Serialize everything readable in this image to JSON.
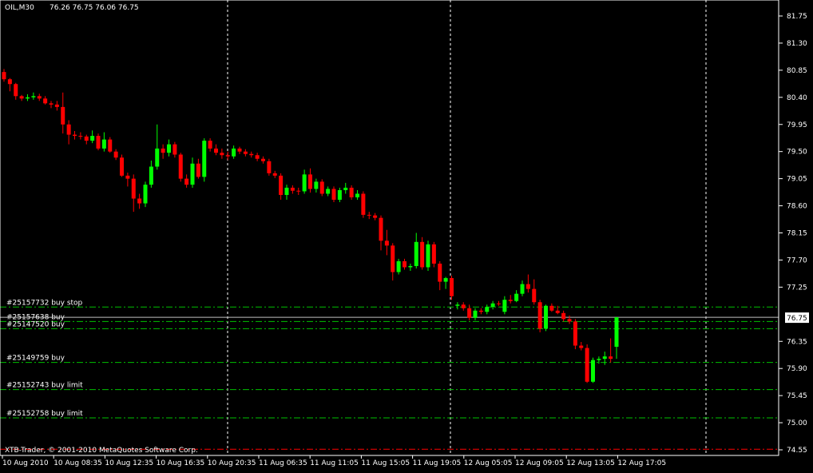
{
  "header": {
    "symbol_timeframe": "OIL,M30",
    "ohlc_readout": "76.26 76.75 76.06 76.75"
  },
  "footer": {
    "copyright": "XTB-Trader, © 2001-2010 MetaQuotes Software Corp."
  },
  "current_price_label": "76.75",
  "colors": {
    "background": "#000000",
    "axis": "#ffffff",
    "bull": "#00ff00",
    "bear": "#ff0000",
    "order_line": "#00c000",
    "current_price_box": "#ffffff",
    "stop_line": "#ff0000"
  },
  "chart_data": {
    "type": "candlestick",
    "ylim": [
      74.5,
      82.0
    ],
    "yticks": [
      "81.75",
      "81.30",
      "80.85",
      "80.40",
      "79.95",
      "79.50",
      "79.05",
      "78.60",
      "78.15",
      "77.70",
      "77.25",
      "76.35",
      "75.90",
      "75.45",
      "75.00",
      "74.55"
    ],
    "xticks": [
      "10 Aug 2010",
      "10 Aug 08:35",
      "10 Aug 12:35",
      "10 Aug 16:35",
      "10 Aug 20:35",
      "11 Aug 06:35",
      "11 Aug 11:05",
      "11 Aug 15:05",
      "11 Aug 19:05",
      "12 Aug 05:05",
      "12 Aug 09:05",
      "12 Aug 13:05",
      "12 Aug 17:05"
    ],
    "vertical_grid_after_tick_index": [
      4,
      8,
      12
    ],
    "candles": [
      {
        "o": 80.82,
        "h": 80.87,
        "l": 80.66,
        "c": 80.7
      },
      {
        "o": 80.7,
        "h": 80.72,
        "l": 80.5,
        "c": 80.62
      },
      {
        "o": 80.62,
        "h": 80.64,
        "l": 80.36,
        "c": 80.42
      },
      {
        "o": 80.42,
        "h": 80.44,
        "l": 80.34,
        "c": 80.38
      },
      {
        "o": 80.38,
        "h": 80.45,
        "l": 80.34,
        "c": 80.4
      },
      {
        "o": 80.4,
        "h": 80.48,
        "l": 80.36,
        "c": 80.42
      },
      {
        "o": 80.42,
        "h": 80.46,
        "l": 80.34,
        "c": 80.38
      },
      {
        "o": 80.38,
        "h": 80.42,
        "l": 80.28,
        "c": 80.3
      },
      {
        "o": 80.3,
        "h": 80.34,
        "l": 80.22,
        "c": 80.28
      },
      {
        "o": 80.28,
        "h": 80.34,
        "l": 80.18,
        "c": 80.24
      },
      {
        "o": 80.24,
        "h": 80.48,
        "l": 79.8,
        "c": 79.95
      },
      {
        "o": 79.95,
        "h": 80.02,
        "l": 79.62,
        "c": 79.78
      },
      {
        "o": 79.78,
        "h": 79.84,
        "l": 79.7,
        "c": 79.76
      },
      {
        "o": 79.76,
        "h": 79.82,
        "l": 79.7,
        "c": 79.75
      },
      {
        "o": 79.75,
        "h": 79.78,
        "l": 79.62,
        "c": 79.68
      },
      {
        "o": 79.68,
        "h": 79.85,
        "l": 79.64,
        "c": 79.76
      },
      {
        "o": 79.76,
        "h": 79.8,
        "l": 79.52,
        "c": 79.55
      },
      {
        "o": 79.55,
        "h": 79.82,
        "l": 79.5,
        "c": 79.7
      },
      {
        "o": 79.7,
        "h": 79.74,
        "l": 79.48,
        "c": 79.5
      },
      {
        "o": 79.5,
        "h": 79.54,
        "l": 79.36,
        "c": 79.4
      },
      {
        "o": 79.4,
        "h": 79.45,
        "l": 79.08,
        "c": 79.1
      },
      {
        "o": 79.1,
        "h": 79.15,
        "l": 78.92,
        "c": 79.05
      },
      {
        "o": 79.05,
        "h": 79.12,
        "l": 78.5,
        "c": 78.72
      },
      {
        "o": 78.72,
        "h": 78.8,
        "l": 78.55,
        "c": 78.64
      },
      {
        "o": 78.64,
        "h": 79.0,
        "l": 78.58,
        "c": 78.95
      },
      {
        "o": 78.95,
        "h": 79.35,
        "l": 78.9,
        "c": 79.25
      },
      {
        "o": 79.25,
        "h": 79.95,
        "l": 79.2,
        "c": 79.55
      },
      {
        "o": 79.55,
        "h": 79.62,
        "l": 79.38,
        "c": 79.48
      },
      {
        "o": 79.48,
        "h": 79.7,
        "l": 79.42,
        "c": 79.62
      },
      {
        "o": 79.62,
        "h": 79.66,
        "l": 79.4,
        "c": 79.45
      },
      {
        "o": 79.45,
        "h": 79.48,
        "l": 79.0,
        "c": 79.05
      },
      {
        "o": 79.05,
        "h": 79.12,
        "l": 78.9,
        "c": 78.95
      },
      {
        "o": 78.95,
        "h": 79.4,
        "l": 78.9,
        "c": 79.3
      },
      {
        "o": 79.3,
        "h": 79.38,
        "l": 79.05,
        "c": 79.08
      },
      {
        "o": 79.08,
        "h": 79.72,
        "l": 79.0,
        "c": 79.68
      },
      {
        "o": 79.68,
        "h": 79.72,
        "l": 79.5,
        "c": 79.55
      },
      {
        "o": 79.55,
        "h": 79.62,
        "l": 79.44,
        "c": 79.48
      },
      {
        "o": 79.48,
        "h": 79.55,
        "l": 79.38,
        "c": 79.44
      },
      {
        "o": 79.44,
        "h": 79.5,
        "l": 79.36,
        "c": 79.42
      },
      {
        "o": 79.42,
        "h": 79.6,
        "l": 79.38,
        "c": 79.55
      },
      {
        "o": 79.55,
        "h": 79.58,
        "l": 79.46,
        "c": 79.5
      },
      {
        "o": 79.5,
        "h": 79.54,
        "l": 79.42,
        "c": 79.46
      },
      {
        "o": 79.46,
        "h": 79.5,
        "l": 79.4,
        "c": 79.44
      },
      {
        "o": 79.44,
        "h": 79.48,
        "l": 79.34,
        "c": 79.38
      },
      {
        "o": 79.38,
        "h": 79.42,
        "l": 79.3,
        "c": 79.34
      },
      {
        "o": 79.34,
        "h": 79.38,
        "l": 79.1,
        "c": 79.14
      },
      {
        "o": 79.14,
        "h": 79.18,
        "l": 79.06,
        "c": 79.1
      },
      {
        "o": 79.1,
        "h": 79.14,
        "l": 78.7,
        "c": 78.78
      },
      {
        "o": 78.78,
        "h": 78.95,
        "l": 78.7,
        "c": 78.9
      },
      {
        "o": 78.9,
        "h": 78.94,
        "l": 78.8,
        "c": 78.85
      },
      {
        "o": 78.85,
        "h": 78.9,
        "l": 78.78,
        "c": 78.84
      },
      {
        "o": 78.84,
        "h": 79.2,
        "l": 78.8,
        "c": 79.12
      },
      {
        "o": 79.12,
        "h": 79.22,
        "l": 78.82,
        "c": 78.88
      },
      {
        "o": 78.88,
        "h": 79.05,
        "l": 78.82,
        "c": 79.0
      },
      {
        "o": 79.0,
        "h": 79.04,
        "l": 78.76,
        "c": 78.8
      },
      {
        "o": 78.8,
        "h": 78.92,
        "l": 78.76,
        "c": 78.88
      },
      {
        "o": 78.88,
        "h": 78.92,
        "l": 78.66,
        "c": 78.7
      },
      {
        "o": 78.7,
        "h": 78.9,
        "l": 78.66,
        "c": 78.86
      },
      {
        "o": 78.86,
        "h": 78.98,
        "l": 78.8,
        "c": 78.9
      },
      {
        "o": 78.9,
        "h": 78.94,
        "l": 78.7,
        "c": 78.74
      },
      {
        "o": 78.74,
        "h": 78.86,
        "l": 78.7,
        "c": 78.8
      },
      {
        "o": 78.8,
        "h": 78.84,
        "l": 78.4,
        "c": 78.45
      },
      {
        "o": 78.45,
        "h": 78.5,
        "l": 78.38,
        "c": 78.44
      },
      {
        "o": 78.44,
        "h": 78.48,
        "l": 78.36,
        "c": 78.4
      },
      {
        "o": 78.4,
        "h": 78.44,
        "l": 77.86,
        "c": 78.02
      },
      {
        "o": 78.02,
        "h": 78.2,
        "l": 77.78,
        "c": 77.94
      },
      {
        "o": 77.94,
        "h": 77.98,
        "l": 77.36,
        "c": 77.5
      },
      {
        "o": 77.5,
        "h": 77.72,
        "l": 77.46,
        "c": 77.68
      },
      {
        "o": 77.68,
        "h": 77.72,
        "l": 77.54,
        "c": 77.58
      },
      {
        "o": 77.58,
        "h": 77.64,
        "l": 77.52,
        "c": 77.6
      },
      {
        "o": 77.6,
        "h": 78.15,
        "l": 77.56,
        "c": 78.0
      },
      {
        "o": 78.0,
        "h": 78.08,
        "l": 77.54,
        "c": 77.58
      },
      {
        "o": 77.58,
        "h": 78.02,
        "l": 77.52,
        "c": 77.96
      },
      {
        "o": 77.96,
        "h": 78.0,
        "l": 77.58,
        "c": 77.64
      },
      {
        "o": 77.64,
        "h": 77.68,
        "l": 77.2,
        "c": 77.34
      },
      {
        "o": 77.34,
        "h": 77.42,
        "l": 77.22,
        "c": 77.4
      },
      {
        "o": 77.4,
        "h": 77.44,
        "l": 77.04,
        "c": 77.1
      },
      {
        "o": 76.94,
        "h": 77.0,
        "l": 76.88,
        "c": 76.96
      },
      {
        "o": 76.96,
        "h": 77.0,
        "l": 76.86,
        "c": 76.9
      },
      {
        "o": 76.9,
        "h": 76.96,
        "l": 76.7,
        "c": 76.74
      },
      {
        "o": 76.74,
        "h": 76.9,
        "l": 76.7,
        "c": 76.86
      },
      {
        "o": 76.86,
        "h": 76.9,
        "l": 76.8,
        "c": 76.84
      },
      {
        "o": 76.84,
        "h": 76.96,
        "l": 76.8,
        "c": 76.92
      },
      {
        "o": 76.92,
        "h": 77.02,
        "l": 76.88,
        "c": 76.98
      },
      {
        "o": 76.98,
        "h": 77.02,
        "l": 76.94,
        "c": 76.97
      },
      {
        "o": 76.84,
        "h": 77.1,
        "l": 76.8,
        "c": 77.04
      },
      {
        "o": 77.04,
        "h": 77.12,
        "l": 76.98,
        "c": 77.02
      },
      {
        "o": 77.02,
        "h": 77.2,
        "l": 77.0,
        "c": 77.14
      },
      {
        "o": 77.14,
        "h": 77.36,
        "l": 77.1,
        "c": 77.3
      },
      {
        "o": 77.3,
        "h": 77.46,
        "l": 77.16,
        "c": 77.22
      },
      {
        "o": 77.22,
        "h": 77.38,
        "l": 76.96,
        "c": 77.0
      },
      {
        "o": 77.0,
        "h": 77.04,
        "l": 76.5,
        "c": 76.56
      },
      {
        "o": 76.56,
        "h": 76.96,
        "l": 76.52,
        "c": 76.94
      },
      {
        "o": 76.94,
        "h": 76.98,
        "l": 76.84,
        "c": 76.86
      },
      {
        "o": 76.86,
        "h": 76.94,
        "l": 76.8,
        "c": 76.82
      },
      {
        "o": 76.82,
        "h": 76.86,
        "l": 76.68,
        "c": 76.72
      },
      {
        "o": 76.72,
        "h": 76.78,
        "l": 76.64,
        "c": 76.68
      },
      {
        "o": 76.68,
        "h": 76.72,
        "l": 76.22,
        "c": 76.28
      },
      {
        "o": 76.28,
        "h": 76.34,
        "l": 76.2,
        "c": 76.24
      },
      {
        "o": 76.24,
        "h": 76.3,
        "l": 75.66,
        "c": 75.68
      },
      {
        "o": 75.68,
        "h": 76.08,
        "l": 75.66,
        "c": 76.04
      },
      {
        "o": 76.04,
        "h": 76.1,
        "l": 75.98,
        "c": 76.06
      },
      {
        "o": 76.06,
        "h": 76.18,
        "l": 75.96,
        "c": 76.1
      },
      {
        "o": 76.1,
        "h": 76.4,
        "l": 76.0,
        "c": 76.06
      },
      {
        "o": 76.26,
        "h": 76.75,
        "l": 76.06,
        "c": 76.75
      }
    ],
    "order_levels": [
      {
        "label": "#25157732 buy stop",
        "price": 76.92
      },
      {
        "label": "#25157638 buy",
        "price": 76.68
      },
      {
        "label": "#25147520 buy",
        "price": 76.56
      },
      {
        "label": "#25149759 buy",
        "price": 76.0
      },
      {
        "label": "#25152743 buy limit",
        "price": 75.55
      },
      {
        "label": "#25152758 buy limit",
        "price": 75.08
      }
    ],
    "bottom_line_price": 74.56,
    "current_price": 76.75
  }
}
